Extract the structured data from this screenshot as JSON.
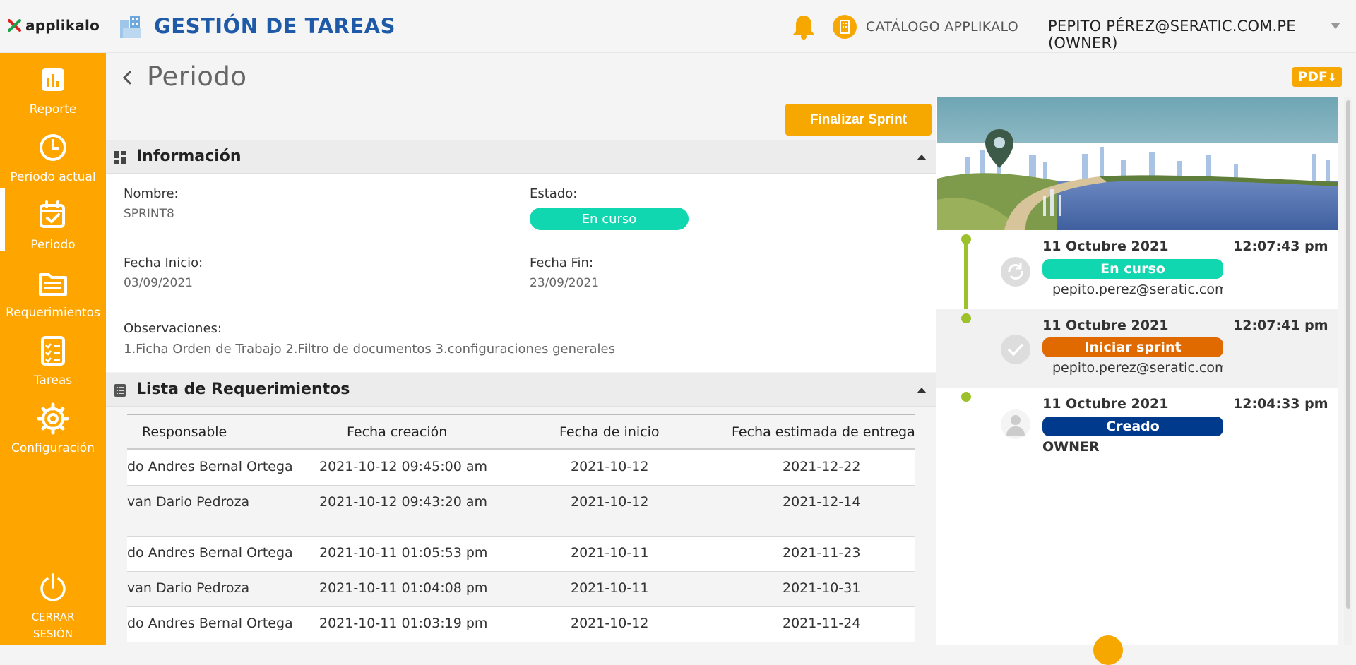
{
  "header": {
    "brand": "applikalo",
    "app_title": "GESTIÓN DE TAREAS",
    "catalog": "CATÁLOGO APPLIKALO",
    "user": "PEPITO PÉREZ@SERATIC.COM.PE (OWNER)",
    "icons": [
      "bell-icon",
      "building-icon"
    ],
    "accent": "#f7a800",
    "title_color": "#1e5aa8"
  },
  "sidebar": {
    "items": [
      {
        "label": "Reporte",
        "icon": "chart-icon"
      },
      {
        "label": "Periodo actual",
        "icon": "clock-icon"
      },
      {
        "label": "Periodo",
        "icon": "calendar-icon",
        "active": true
      },
      {
        "label": "Requerimientos",
        "icon": "folder-icon"
      },
      {
        "label": "Tareas",
        "icon": "checklist-icon"
      },
      {
        "label": "Configuración",
        "icon": "gear-icon"
      }
    ],
    "logout_line1": "CERRAR",
    "logout_line2": "SESIÓN",
    "bg": "#ffa500"
  },
  "main": {
    "title": "Periodo",
    "finish_button": "Finalizar Sprint",
    "info": {
      "title": "Información",
      "nombre_label": "Nombre:",
      "nombre": "SPRINT8",
      "estado_label": "Estado:",
      "estado": "En curso",
      "fecha_inicio_label": "Fecha Inicio:",
      "fecha_inicio": "03/09/2021",
      "fecha_fin_label": "Fecha Fin:",
      "fecha_fin": "23/09/2021",
      "observaciones_label": "Observaciones:",
      "observaciones": "1.Ficha Orden de Trabajo 2.Filtro de documentos 3.configuraciones generales"
    },
    "requirements": {
      "title": "Lista de Requerimientos",
      "columns": [
        "Responsable",
        "Fecha creación",
        "Fecha de inicio",
        "Fecha estimada de entrega"
      ],
      "rows": [
        [
          "do Andres Bernal Ortega",
          "2021-10-12 09:45:00 am",
          "2021-10-12",
          "2021-12-22"
        ],
        [
          "van Dario Pedroza",
          "2021-10-12 09:43:20 am",
          "2021-10-12",
          "2021-12-14"
        ],
        [
          "do Andres Bernal Ortega",
          "2021-10-11 01:05:53 pm",
          "2021-10-11",
          "2021-11-23"
        ],
        [
          "van Dario Pedroza",
          "2021-10-11 01:04:08 pm",
          "2021-10-11",
          "2021-10-31"
        ],
        [
          "do Andres Bernal Ortega",
          "2021-10-11 01:03:19 pm",
          "2021-10-12",
          "2021-11-24"
        ]
      ]
    }
  },
  "panel": {
    "pdf": "PDF",
    "timeline": [
      {
        "date": "11 Octubre 2021",
        "time": "12:07:43 pm",
        "status": "En curso",
        "color": "#10d7b0",
        "user": "pepito.perez@seratic.com.pe",
        "icon": "refresh-icon"
      },
      {
        "date": "11 Octubre 2021",
        "time": "12:07:41 pm",
        "status": "Iniciar sprint",
        "color": "#e06a00",
        "user": "pepito.perez@seratic.com.pe",
        "icon": "check-icon"
      },
      {
        "date": "11 Octubre 2021",
        "time": "12:04:33 pm",
        "status": "Creado",
        "color": "#003a8c",
        "user": "OWNER",
        "icon": "person-icon"
      }
    ]
  }
}
